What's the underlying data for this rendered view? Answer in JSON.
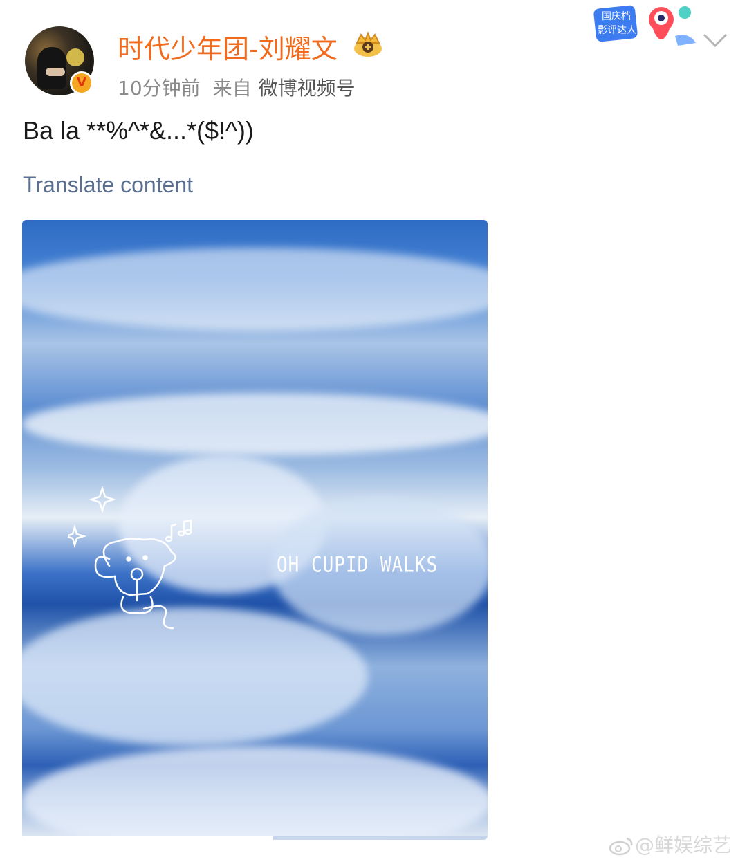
{
  "post": {
    "author": {
      "name": "时代少年团-刘耀文",
      "verified_mark": "V"
    },
    "meta": {
      "time": "10分钟前",
      "source_prefix": "来自",
      "source_app": "微博视频号"
    },
    "badge": {
      "line1": "国庆档",
      "line2": "影评达人"
    },
    "text": "Ba la **%^*&...*($!^))",
    "translate_label": "Translate content",
    "media": {
      "caption": "OH CUPID WALKS",
      "playback_progress": 0.54
    }
  },
  "watermark": {
    "text": "@鲜娱综艺"
  },
  "colors": {
    "username": "#f26b1d",
    "translate_link": "#5b6f90",
    "meta_text": "#8a8a8a"
  },
  "icons": {
    "verified": "verified-v-icon",
    "crown": "crown-icon",
    "chevron": "chevron-down-icon",
    "watermark_logo": "weibo-logo-icon"
  }
}
